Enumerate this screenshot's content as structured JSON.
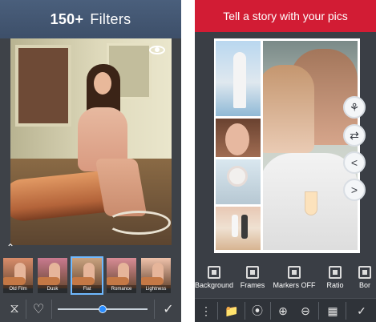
{
  "left": {
    "header": {
      "count": "150+",
      "word": "Filters"
    },
    "filters": [
      {
        "label": "Old Film",
        "tint": "#d98d6b",
        "selected": false
      },
      {
        "label": "Dusk",
        "tint": "#c97a8f",
        "selected": false
      },
      {
        "label": "Flat",
        "tint": "#c9a27f",
        "selected": true
      },
      {
        "label": "Romance",
        "tint": "#d88c96",
        "selected": false
      },
      {
        "label": "Lightness",
        "tint": "#efc2ab",
        "selected": false
      }
    ],
    "slider": {
      "value": 0.5
    },
    "toolbar": {
      "history": "⧖",
      "favorite": "♡",
      "confirm": "✓"
    }
  },
  "right": {
    "header": {
      "title": "Tell a story with your pics"
    },
    "fabs": [
      {
        "name": "shuffle-icon",
        "glyph": "⚘"
      },
      {
        "name": "swap-icon",
        "glyph": "⇄"
      },
      {
        "name": "share-icon",
        "glyph": "<"
      },
      {
        "name": "flip-icon",
        "glyph": ">"
      }
    ],
    "tools": [
      {
        "label": "Background",
        "icon": "background-icon"
      },
      {
        "label": "Frames",
        "icon": "frames-icon"
      },
      {
        "label": "Markers OFF",
        "icon": "markers-icon"
      },
      {
        "label": "Ratio",
        "icon": "ratio-icon"
      },
      {
        "label": "Bor",
        "icon": "border-icon"
      }
    ],
    "toolbar": {
      "menu": "⋮",
      "folder": "📁",
      "add_photo": "⦿",
      "zoom_in": "⊕",
      "zoom_out": "⊖",
      "qr": "▦",
      "confirm": "✓"
    }
  }
}
